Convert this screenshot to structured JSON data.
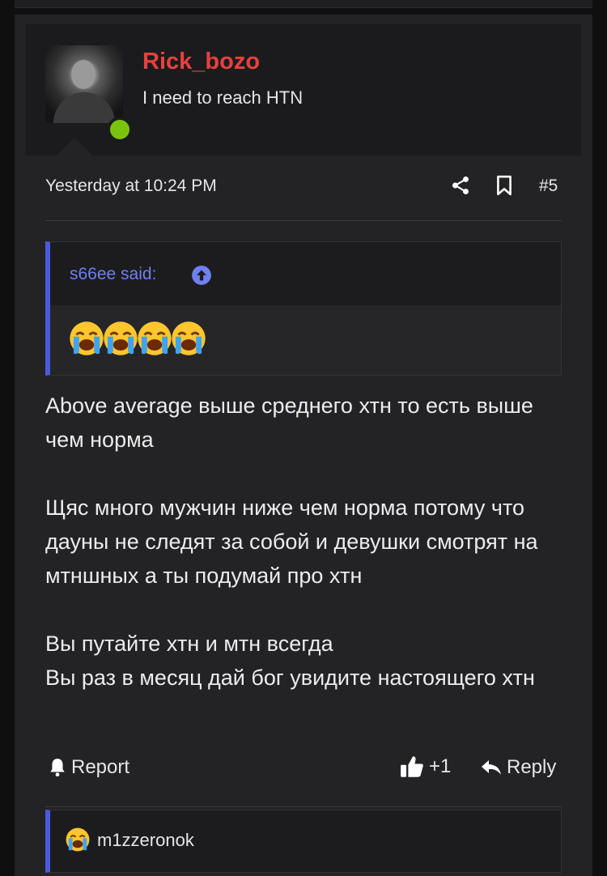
{
  "post": {
    "username": "Rick_bozo",
    "user_title": "I need to reach HTN",
    "timestamp": "Yesterday at 10:24 PM",
    "post_number": "#5",
    "quote": {
      "author": "s66ee said:",
      "emoji_count": 4,
      "emoji": "loudly-crying-face"
    },
    "message": "Above average выше среднего хтн то есть выше чем норма\n\nЩяс много мужчин ниже чем норма потому что дауны не следят за собой и девушки смотрят на мтншных а ты подумай про хтн\n\nВы путайте хтн и мтн всегда\nВы раз в месяц дай бог увидите настоящего хтн",
    "actions": {
      "report": "Report",
      "like_count": "+1",
      "reply": "Reply"
    },
    "reactions": {
      "emoji": "loudly-crying-face",
      "reactor": "m1zzeronok"
    }
  },
  "colors": {
    "username": "#e8403f",
    "quote_accent": "#4a5ae0",
    "online": "#7bc20e"
  }
}
